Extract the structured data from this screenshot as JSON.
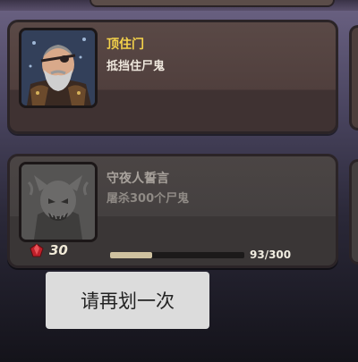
{
  "achievements": [
    {
      "title": "顶住门",
      "description": "抵挡住尸鬼",
      "title_color": "#f4d24a",
      "status": "unlocked",
      "icon": "bearded-hero-portrait-icon"
    },
    {
      "title": "守夜人誓言",
      "description": "屠杀300个尸鬼",
      "title_color": "#a8a29c",
      "status": "locked",
      "icon": "locked-demon-portrait-icon",
      "reward": "30",
      "reward_icon": "red-gem-icon",
      "progress_text": "93/300",
      "progress": 0.31
    }
  ],
  "toast": {
    "message": "请再划一次"
  }
}
